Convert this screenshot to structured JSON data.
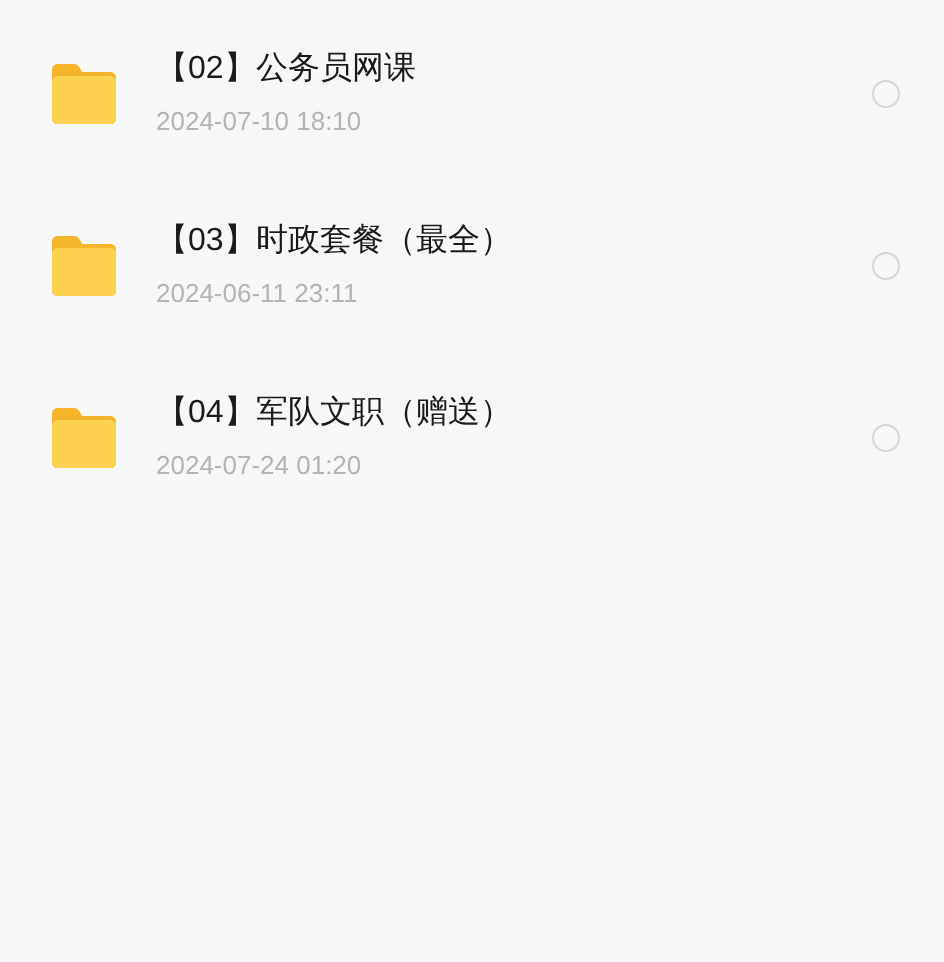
{
  "files": [
    {
      "name": "【02】公务员网课",
      "date": "2024-07-10 18:10",
      "selected": false
    },
    {
      "name": "【03】时政套餐（最全）",
      "date": "2024-06-11 23:11",
      "selected": false
    },
    {
      "name": "【04】军队文职（赠送）",
      "date": "2024-07-24 01:20",
      "selected": false
    }
  ]
}
